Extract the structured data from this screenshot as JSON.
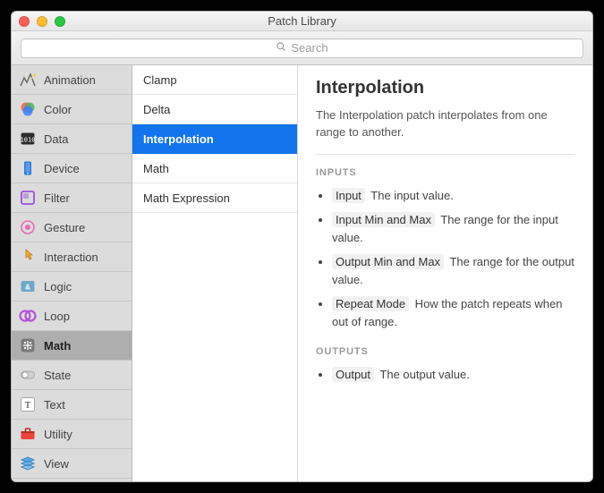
{
  "window": {
    "title": "Patch Library"
  },
  "search": {
    "placeholder": "Search"
  },
  "sidebar": {
    "items": [
      {
        "label": "Animation"
      },
      {
        "label": "Color"
      },
      {
        "label": "Data"
      },
      {
        "label": "Device"
      },
      {
        "label": "Filter"
      },
      {
        "label": "Gesture"
      },
      {
        "label": "Interaction"
      },
      {
        "label": "Logic"
      },
      {
        "label": "Loop"
      },
      {
        "label": "Math"
      },
      {
        "label": "State"
      },
      {
        "label": "Text"
      },
      {
        "label": "Utility"
      },
      {
        "label": "View"
      }
    ],
    "selected_index": 9
  },
  "mid": {
    "items": [
      {
        "label": "Clamp"
      },
      {
        "label": "Delta"
      },
      {
        "label": "Interpolation"
      },
      {
        "label": "Math"
      },
      {
        "label": "Math Expression"
      }
    ],
    "selected_index": 2
  },
  "detail": {
    "title": "Interpolation",
    "description": "The Interpolation patch interpolates from one range to another.",
    "inputs_heading": "INPUTS",
    "inputs": [
      {
        "name": "Input",
        "desc": "The input value."
      },
      {
        "name": "Input Min and Max",
        "desc": "The range for the input value."
      },
      {
        "name": "Output Min and Max",
        "desc": "The range for the output value."
      },
      {
        "name": "Repeat Mode",
        "desc": "How the patch repeats when out of range."
      }
    ],
    "outputs_heading": "OUTPUTS",
    "outputs": [
      {
        "name": "Output",
        "desc": "The output value."
      }
    ]
  }
}
